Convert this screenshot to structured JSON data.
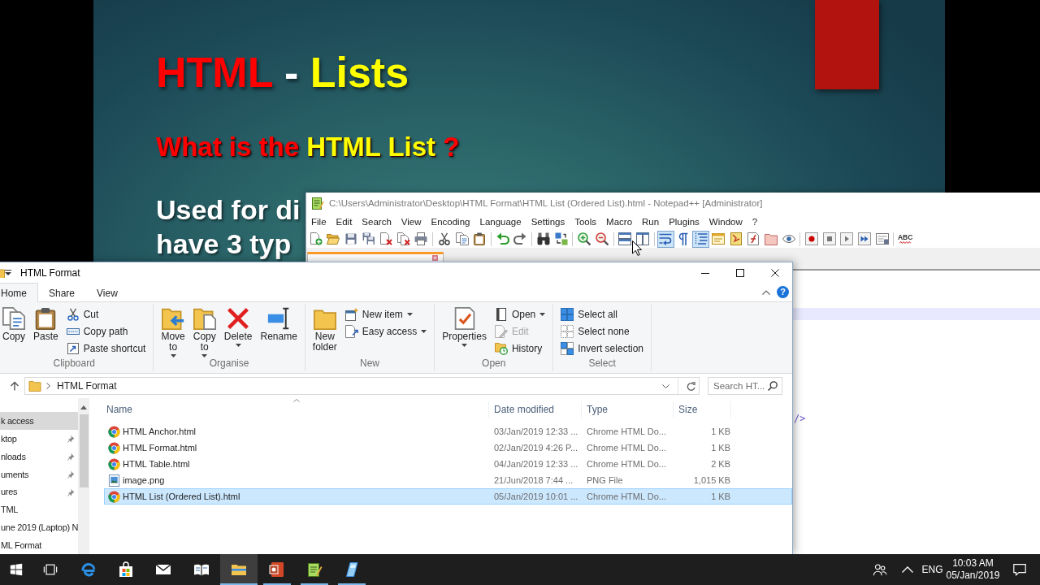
{
  "slide": {
    "title": [
      {
        "text": "HTML",
        "color": "#ff0000"
      },
      {
        "text": "-",
        "color": "#ffffff"
      },
      {
        "text": "Lists",
        "color": "#ffff00"
      }
    ],
    "subtitle": [
      {
        "text": "What is the",
        "color": "#ff0000"
      },
      {
        "text": "HTML List",
        "color": "#ffff00"
      },
      {
        "text": "?",
        "color": "#ff0000"
      }
    ],
    "body_lines": [
      "Used for di",
      "have 3 typ"
    ]
  },
  "notepad": {
    "title": "C:\\Users\\Administrator\\Desktop\\HTML Format\\HTML List (Ordered List).html - Notepad++ [Administrator]",
    "menu": [
      "File",
      "Edit",
      "Search",
      "View",
      "Encoding",
      "Language",
      "Settings",
      "Tools",
      "Macro",
      "Run",
      "Plugins",
      "Window",
      "?"
    ],
    "toolbar": [
      [
        {
          "kind": "new",
          "pressed": false
        },
        {
          "kind": "open",
          "pressed": false
        },
        {
          "kind": "save",
          "pressed": false
        },
        {
          "kind": "saveall",
          "pressed": false
        },
        {
          "kind": "close",
          "pressed": false
        },
        {
          "kind": "closeall",
          "pressed": false
        },
        {
          "kind": "print",
          "pressed": false
        }
      ],
      [
        {
          "kind": "cut",
          "pressed": false
        },
        {
          "kind": "copy",
          "pressed": false
        },
        {
          "kind": "paste",
          "pressed": false
        }
      ],
      [
        {
          "kind": "undo",
          "pressed": false
        },
        {
          "kind": "redo",
          "pressed": false
        }
      ],
      [
        {
          "kind": "find",
          "pressed": false
        },
        {
          "kind": "replace",
          "pressed": false
        }
      ],
      [
        {
          "kind": "zoomin",
          "pressed": false
        },
        {
          "kind": "zoomout",
          "pressed": false
        }
      ],
      [
        {
          "kind": "syncv",
          "pressed": false
        },
        {
          "kind": "synch",
          "pressed": false
        }
      ],
      [
        {
          "kind": "wrap",
          "pressed": true
        },
        {
          "kind": "allchars",
          "pressed": false
        },
        {
          "kind": "indent",
          "pressed": true
        },
        {
          "kind": "udl",
          "pressed": false
        },
        {
          "kind": "docmap",
          "pressed": false
        },
        {
          "kind": "funclist",
          "pressed": false
        },
        {
          "kind": "workspace",
          "pressed": false
        },
        {
          "kind": "monitor",
          "pressed": false
        }
      ],
      [
        {
          "kind": "record",
          "pressed": false
        },
        {
          "kind": "stop",
          "pressed": false
        },
        {
          "kind": "play",
          "pressed": false
        },
        {
          "kind": "playmulti",
          "pressed": false
        },
        {
          "kind": "savemacro",
          "pressed": false
        }
      ],
      [
        {
          "kind": "spellcheck",
          "label": "ABC"
        }
      ]
    ],
    "tabs": [
      {
        "selected": true
      }
    ],
    "editor": {
      "code": "/>"
    }
  },
  "explorer": {
    "title": "HTML Format",
    "ribbon_tabs": [
      {
        "label": "Home",
        "selected": true
      },
      {
        "label": "Share",
        "selected": false
      },
      {
        "label": "View",
        "selected": false
      }
    ],
    "help": "?",
    "groups": [
      {
        "label": "Clipboard",
        "large": [
          {
            "kind": "copy",
            "label": "Copy",
            "dropdown": false
          },
          {
            "kind": "paste",
            "label": "Paste",
            "dropdown": false
          }
        ],
        "small": [
          {
            "kind": "cut",
            "label": "Cut",
            "dropdown": false,
            "disabled": false
          },
          {
            "kind": "copypath",
            "label": "Copy path",
            "dropdown": false,
            "disabled": false
          },
          {
            "kind": "pasteshortcut",
            "label": "Paste shortcut",
            "dropdown": false,
            "disabled": false
          }
        ]
      },
      {
        "label": "Organise",
        "large": [
          {
            "kind": "moveto",
            "label": "Move to",
            "dropdown": true
          },
          {
            "kind": "copyto",
            "label": "Copy to",
            "dropdown": true
          },
          {
            "kind": "delete",
            "label": "Delete",
            "dropdown": true
          },
          {
            "kind": "rename",
            "label": "Rename",
            "dropdown": false
          }
        ]
      },
      {
        "label": "New",
        "large": [
          {
            "kind": "newfolder",
            "label": "New folder",
            "dropdown": false
          }
        ],
        "small": [
          {
            "kind": "newitem",
            "label": "New item",
            "dropdown": true,
            "disabled": false
          },
          {
            "kind": "easyaccess",
            "label": "Easy access",
            "dropdown": true,
            "disabled": false
          }
        ]
      },
      {
        "label": "Open",
        "large": [
          {
            "kind": "properties",
            "label": "Properties",
            "dropdown": true
          }
        ],
        "small": [
          {
            "kind": "open",
            "label": "Open",
            "dropdown": true,
            "disabled": false
          },
          {
            "kind": "edit",
            "label": "Edit",
            "dropdown": false,
            "disabled": true
          },
          {
            "kind": "history",
            "label": "History",
            "dropdown": false,
            "disabled": false
          }
        ]
      },
      {
        "label": "Select",
        "small": [
          {
            "kind": "selectall",
            "label": "Select all",
            "dropdown": false,
            "disabled": false
          },
          {
            "kind": "selectnone",
            "label": "Select none",
            "dropdown": false,
            "disabled": false
          },
          {
            "kind": "invert",
            "label": "Invert selection",
            "dropdown": false,
            "disabled": false
          }
        ]
      }
    ],
    "address": "HTML Format",
    "search": {
      "placeholder": "Search HT..."
    },
    "nav": [
      {
        "label": "k access",
        "selected": true,
        "pinned": false
      },
      {
        "label": "ktop",
        "selected": false,
        "pinned": true
      },
      {
        "label": "nloads",
        "selected": false,
        "pinned": true
      },
      {
        "label": "uments",
        "selected": false,
        "pinned": true
      },
      {
        "label": "ures",
        "selected": false,
        "pinned": true
      },
      {
        "label": "TML",
        "selected": false,
        "pinned": false
      },
      {
        "label": "une 2019 (Laptop) N",
        "selected": false,
        "pinned": false
      },
      {
        "label": "ML Format",
        "selected": false,
        "pinned": false
      }
    ],
    "columns": [
      {
        "label": "Name",
        "sorted": true
      },
      {
        "label": "Date modified",
        "sorted": false
      },
      {
        "label": "Type",
        "sorted": false
      },
      {
        "label": "Size",
        "sorted": false
      }
    ],
    "files": [
      {
        "kind": "html",
        "name": "HTML Anchor.html",
        "date": "03/Jan/2019 12:33 ...",
        "type": "Chrome HTML Do...",
        "size": "1 KB",
        "selected": false
      },
      {
        "kind": "html",
        "name": "HTML Format.html",
        "date": "02/Jan/2019 4:26 P...",
        "type": "Chrome HTML Do...",
        "size": "1 KB",
        "selected": false
      },
      {
        "kind": "html",
        "name": "HTML Table.html",
        "date": "04/Jan/2019 12:33 ...",
        "type": "Chrome HTML Do...",
        "size": "2 KB",
        "selected": false
      },
      {
        "kind": "image",
        "name": "image.png",
        "date": "21/Jun/2018 7:44 ...",
        "type": "PNG File",
        "size": "1,015 KB",
        "selected": false
      },
      {
        "kind": "html",
        "name": "HTML List (Ordered List).html",
        "date": "05/Jan/2019 10:01 ...",
        "type": "Chrome HTML Do...",
        "size": "1 KB",
        "selected": true
      }
    ]
  },
  "taskbar": {
    "apps": [
      {
        "kind": "start",
        "running": false,
        "selected": false
      },
      {
        "kind": "taskview",
        "running": false,
        "selected": false
      },
      {
        "kind": "edge",
        "running": false,
        "selected": false
      },
      {
        "kind": "store",
        "running": false,
        "selected": false
      },
      {
        "kind": "mail",
        "running": false,
        "selected": false
      },
      {
        "kind": "reader",
        "running": false,
        "selected": false
      },
      {
        "kind": "explorer",
        "running": true,
        "selected": true
      },
      {
        "kind": "powerpoint",
        "running": true,
        "selected": false
      },
      {
        "kind": "notepad",
        "running": true,
        "selected": false
      },
      {
        "kind": "glass",
        "running": true,
        "selected": false
      }
    ],
    "language": "ENG",
    "time": "10:03 AM",
    "date": "05/Jan/2019"
  }
}
